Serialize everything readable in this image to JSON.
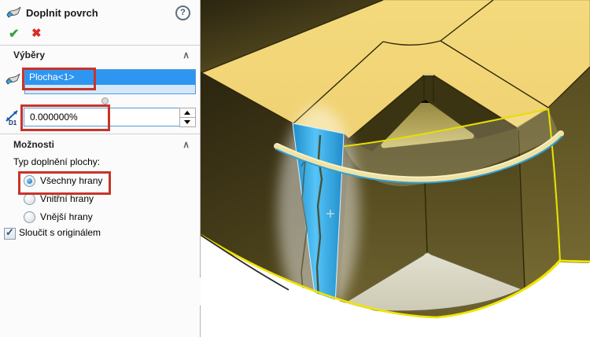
{
  "panel": {
    "title": "Doplnit povrch",
    "header": {
      "help_icon": "?",
      "confirm_icon": "✔",
      "cancel_icon": "✖"
    },
    "sections": {
      "selections": {
        "title": "Výběry",
        "collapse_icon": "∧",
        "selection_item": "Plocha<1>",
        "distance_icon_label": "D1",
        "distance_value": "0.000000%"
      },
      "options": {
        "title": "Možnosti",
        "collapse_icon": "∧",
        "type_label": "Typ doplnění plochy:",
        "radios": [
          {
            "label": "Všechny hrany",
            "selected": true,
            "annotated": true
          },
          {
            "label": "Vnitřní hrany",
            "selected": false
          },
          {
            "label": "Vnější hrany",
            "selected": false
          }
        ],
        "checkbox": {
          "label": "Sloučit s originálem",
          "checked": true,
          "check_glyph": "✓"
        }
      }
    },
    "annotation_color": "#c8342a"
  },
  "viewport": {
    "background": "#ffffff",
    "model_color": "#f2d878",
    "selected_face_color": "#2fa8e8",
    "highlight_edge_color": "#f0e400",
    "selected_face": "Plocha<1>"
  }
}
